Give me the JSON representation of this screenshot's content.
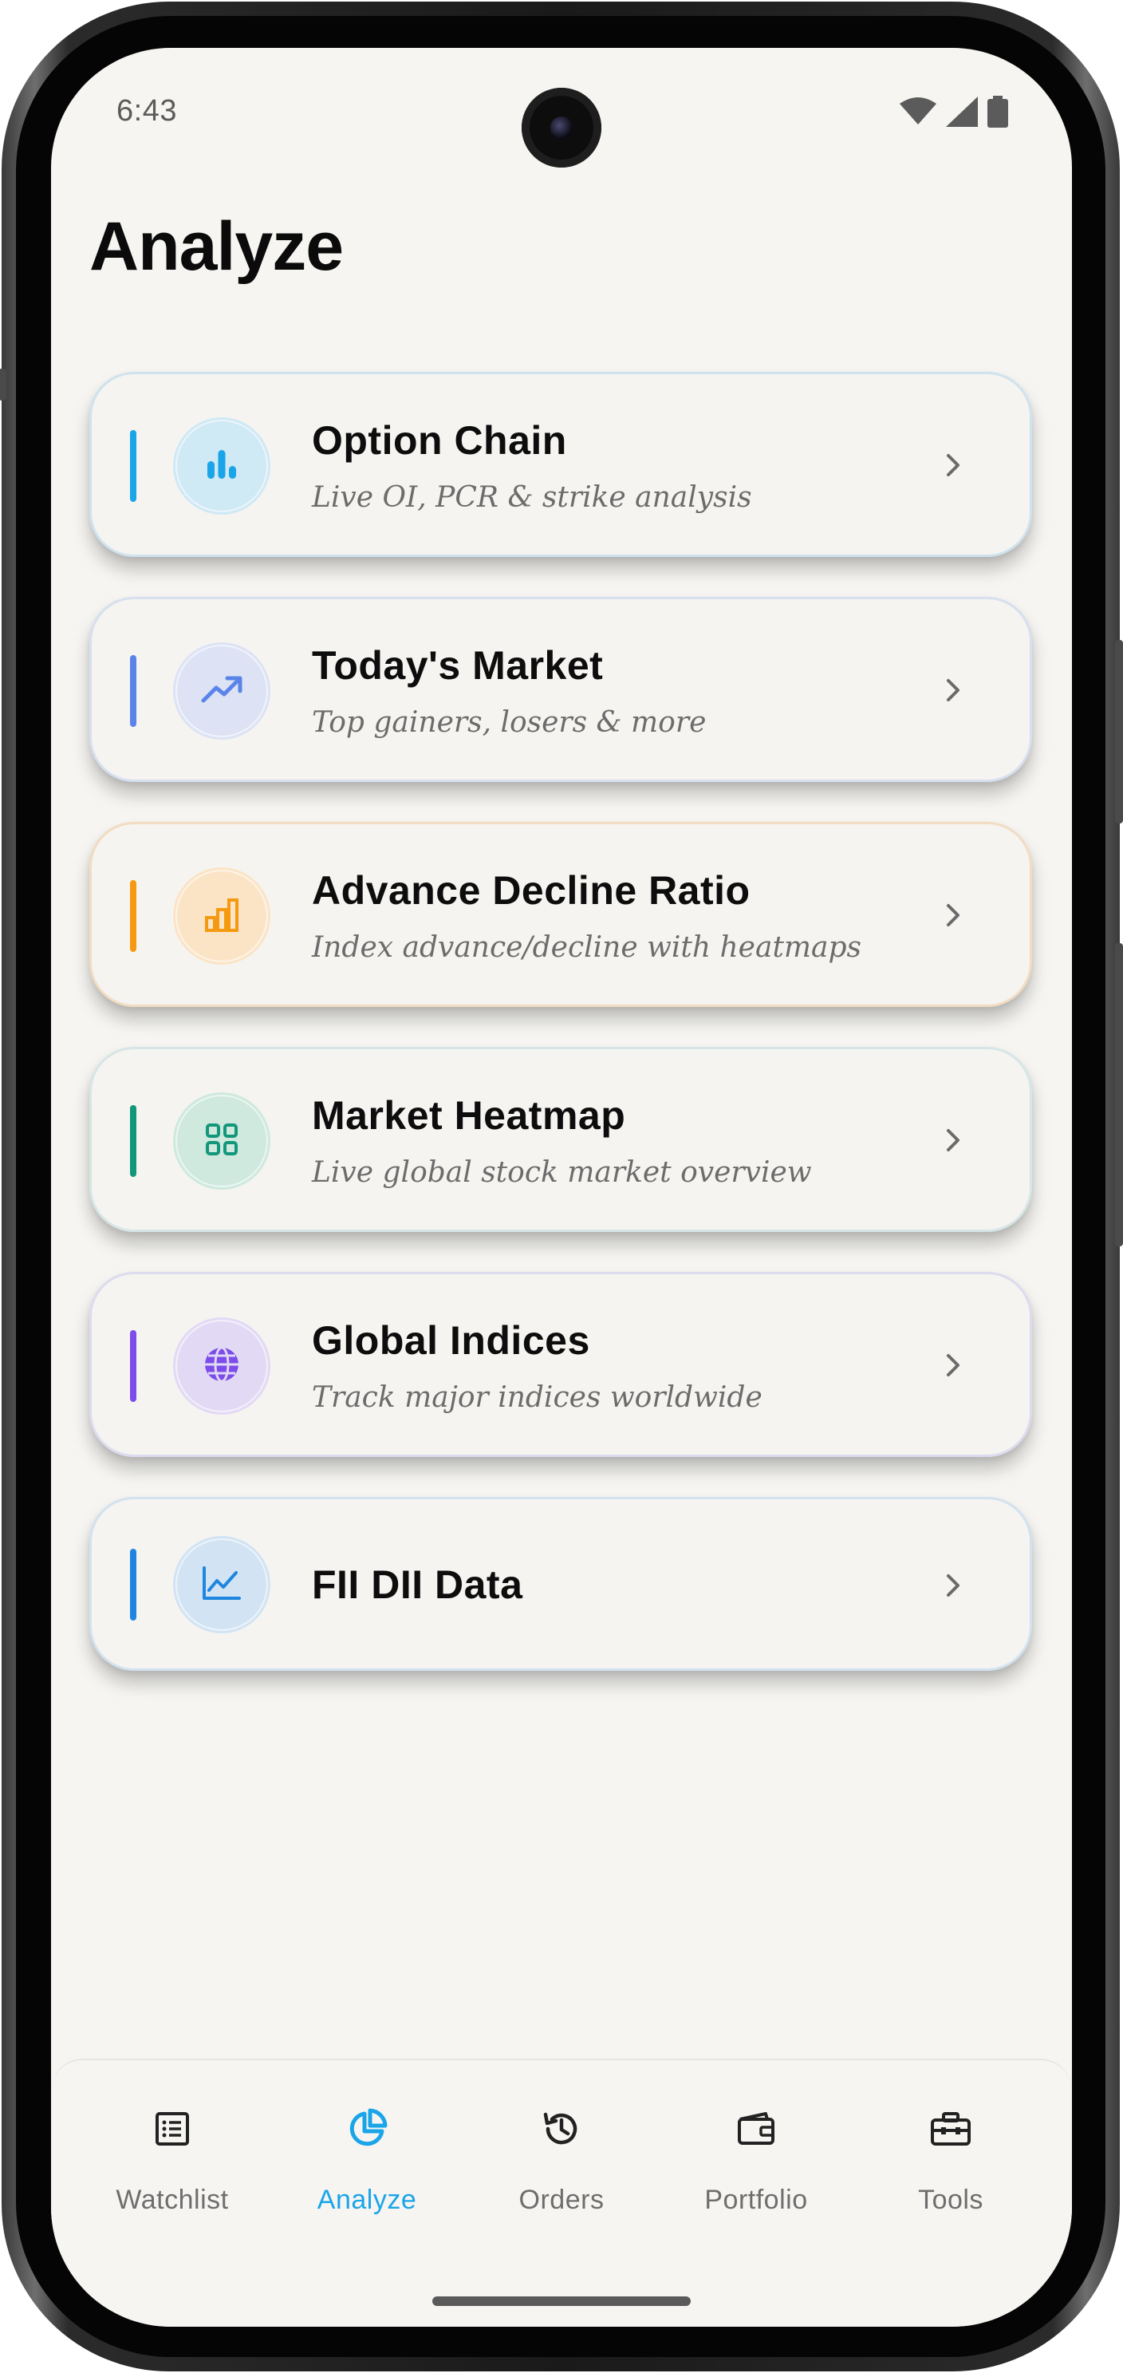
{
  "status_bar": {
    "time": "6:43",
    "icons": [
      "wifi-icon",
      "signal-icon",
      "battery-icon"
    ]
  },
  "page": {
    "title": "Analyze"
  },
  "cards": [
    {
      "title": "Option Chain",
      "subtitle": "Live OI, PCR & strike analysis",
      "icon": "bar-chart-icon",
      "accent": "#1aa5e8",
      "icon_bg": "#cfe9f5",
      "border": "#cfe3ee"
    },
    {
      "title": "Today's Market",
      "subtitle": "Top gainers, losers & more",
      "icon": "trending-up-icon",
      "accent": "#5b84ea",
      "icon_bg": "#dde3f5",
      "border": "#d6e0ee"
    },
    {
      "title": "Advance Decline Ratio",
      "subtitle": "Index advance/decline with heatmaps",
      "icon": "rising-bars-icon",
      "accent": "#f59a10",
      "icon_bg": "#fbe4c6",
      "border": "#f2dcc2"
    },
    {
      "title": "Market Heatmap",
      "subtitle": "Live global stock market overview",
      "icon": "grid-icon",
      "accent": "#12977a",
      "icon_bg": "#cfe9df",
      "border": "#d6e6e6"
    },
    {
      "title": "Global Indices",
      "subtitle": "Track major indices worldwide",
      "icon": "globe-icon",
      "accent": "#7c4dea",
      "icon_bg": "#e2daf5",
      "border": "#dcdcee"
    },
    {
      "title": "FII DII Data",
      "subtitle": "",
      "icon": "line-chart-icon",
      "accent": "#1f86e0",
      "icon_bg": "#d2e4f3",
      "border": "#d2e2ee"
    }
  ],
  "bottom_nav": {
    "active": "Analyze",
    "active_color": "#1aa5e8",
    "items": [
      {
        "label": "Watchlist",
        "icon": "list-icon"
      },
      {
        "label": "Analyze",
        "icon": "pie-chart-icon"
      },
      {
        "label": "Orders",
        "icon": "history-icon"
      },
      {
        "label": "Portfolio",
        "icon": "wallet-icon"
      },
      {
        "label": "Tools",
        "icon": "toolbox-icon"
      }
    ]
  }
}
